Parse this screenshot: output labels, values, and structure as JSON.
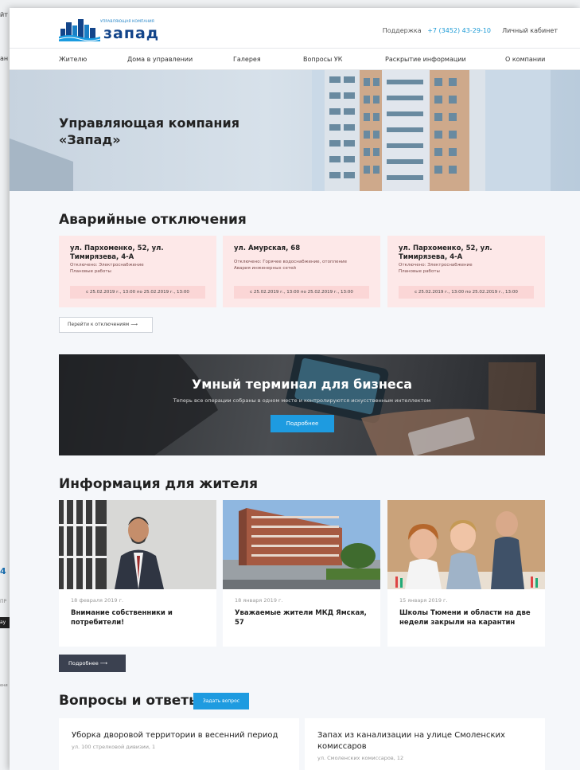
{
  "background": {
    "labels": [
      "йт",
      "ан",
      "4",
      "ПР",
      "ay",
      "ени"
    ]
  },
  "header": {
    "logo": {
      "subtitle": "управляющая компания",
      "name": "запад"
    },
    "support_label": "Поддержка",
    "phone": "+7 (3452) 43-29-10",
    "cabinet": "Личный кабинет"
  },
  "nav": [
    "Жителю",
    "Дома в управлении",
    "Галерея",
    "Вопросы УК",
    "Раскрытие информации",
    "О компании"
  ],
  "hero": {
    "title": "Управляющая компания «Запад»"
  },
  "outages": {
    "title": "Аварийные отключения",
    "cards": [
      {
        "address": "ул. Пархоменко, 52, ул. Тимирязева, 4-А",
        "details": [
          "Отключено: Электроснабжение",
          "Плановые работы"
        ],
        "dates": "с 25.02.2019 г., 13:00    по 25.02.2019 г., 13:00"
      },
      {
        "address": "ул. Амурская, 68",
        "details": [
          "Отключено: Горячее водоснабжение, отопление",
          "Авария инженерных сетей"
        ],
        "dates": "с 25.02.2019 г., 13:00    по 25.02.2019 г., 13:00"
      },
      {
        "address": "ул. Пархоменко, 52, ул. Тимирязева, 4-А",
        "details": [
          "Отключено: Электроснабжение",
          "Плановые работы"
        ],
        "dates": "с 25.02.2019 г., 13:00    по 25.02.2019 г., 13:00"
      }
    ],
    "button": "Перейти к отключениям  ⟶"
  },
  "banner": {
    "title": "Умный терминал для бизнеса",
    "subtitle": "Теперь все операции собраны в одном месте и контролируются искусственным интеллектом",
    "button": "Подробнее"
  },
  "info": {
    "title": "Информация  для жителя",
    "news": [
      {
        "date": "18 февраля 2019 г.",
        "title": "Внимание собственники и потребители!"
      },
      {
        "date": "18 января 2019 г.",
        "title": "Уважаемые жители МКД Ямская, 57"
      },
      {
        "date": "15 января 2019 г.",
        "title": "Школы Тюмени и области на две недели закрыли на карантин"
      }
    ],
    "button": "Подробнее   ⟶"
  },
  "qa": {
    "title": "Вопросы и ответы",
    "ask_button": "Задать вопрос",
    "items": [
      {
        "title": "Уборка дворовой территории в весенний период",
        "subtitle": "ул. 100 стрелковой дивизии, 1"
      },
      {
        "title": "Запах из канализации на улице Смоленских комиссаров",
        "subtitle": "ул. Смоленских комиссаров, 12"
      }
    ]
  },
  "colors": {
    "accent": "#1e9be0",
    "brand": "#13458a",
    "outage_bg": "#fde8e8",
    "dark_button": "#3b4150"
  }
}
